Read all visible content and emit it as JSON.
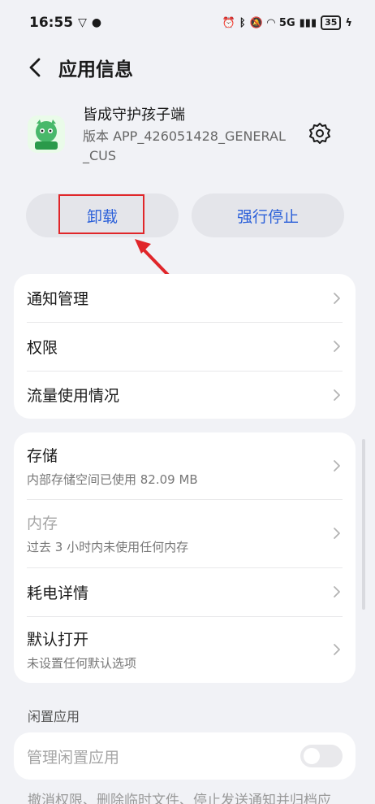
{
  "status_bar": {
    "time": "16:55",
    "battery": "35",
    "network": "5G"
  },
  "header": {
    "title": "应用信息"
  },
  "app": {
    "name": "皆成守护孩子端",
    "version": "版本 APP_426051428_GENERAL_CUS",
    "icon_label": "孩子端"
  },
  "actions": {
    "uninstall": "卸载",
    "force_stop": "强行停止"
  },
  "card1": [
    {
      "title": "通知管理"
    },
    {
      "title": "权限"
    },
    {
      "title": "流量使用情况"
    }
  ],
  "card2": [
    {
      "title": "存储",
      "subtitle": "内部存储空间已使用 82.09 MB"
    },
    {
      "title": "内存",
      "subtitle": "过去 3 小时内未使用任何内存"
    },
    {
      "title": "耗电详情"
    },
    {
      "title": "默认打开",
      "subtitle": "未设置任何默认选项"
    }
  ],
  "idle": {
    "section_label": "闲置应用",
    "manage_label": "管理闲置应用",
    "toggle_on": false,
    "description": "撤消权限、删除临时文件、停止发送通知并归档应"
  },
  "colors": {
    "accent": "#2a5fd9",
    "highlight": "#e0262a",
    "background": "#f1f2f6"
  }
}
